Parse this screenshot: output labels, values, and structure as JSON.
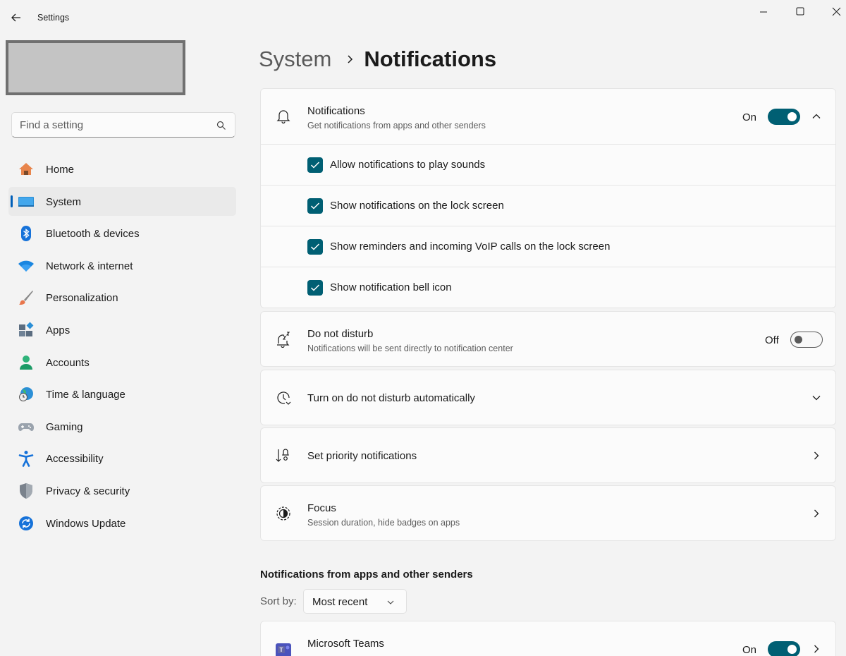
{
  "app": {
    "title": "Settings"
  },
  "search": {
    "placeholder": "Find a setting"
  },
  "sidebar": {
    "items": [
      {
        "label": "Home",
        "icon": "home-icon"
      },
      {
        "label": "System",
        "icon": "system-icon",
        "active": true
      },
      {
        "label": "Bluetooth & devices",
        "icon": "bluetooth-icon"
      },
      {
        "label": "Network & internet",
        "icon": "wifi-icon"
      },
      {
        "label": "Personalization",
        "icon": "brush-icon"
      },
      {
        "label": "Apps",
        "icon": "apps-icon"
      },
      {
        "label": "Accounts",
        "icon": "person-icon"
      },
      {
        "label": "Time & language",
        "icon": "globe-clock-icon"
      },
      {
        "label": "Gaming",
        "icon": "controller-icon"
      },
      {
        "label": "Accessibility",
        "icon": "accessibility-icon"
      },
      {
        "label": "Privacy & security",
        "icon": "shield-icon"
      },
      {
        "label": "Windows Update",
        "icon": "update-icon"
      }
    ]
  },
  "breadcrumb": {
    "parent": "System",
    "current": "Notifications"
  },
  "notifications": {
    "title": "Notifications",
    "description": "Get notifications from apps and other senders",
    "state": "On",
    "options": [
      {
        "label": "Allow notifications to play sounds",
        "checked": true
      },
      {
        "label": "Show notifications on the lock screen",
        "checked": true
      },
      {
        "label": "Show reminders and incoming VoIP calls on the lock screen",
        "checked": true
      },
      {
        "label": "Show notification bell icon",
        "checked": true
      }
    ]
  },
  "dnd": {
    "title": "Do not disturb",
    "description": "Notifications will be sent directly to notification center",
    "state": "Off"
  },
  "auto_dnd": {
    "title": "Turn on do not disturb automatically"
  },
  "priority": {
    "title": "Set priority notifications"
  },
  "focus": {
    "title": "Focus",
    "description": "Session duration, hide badges on apps"
  },
  "apps_section": {
    "title": "Notifications from apps and other senders",
    "sort_label": "Sort by:",
    "sort_value": "Most recent",
    "apps": [
      {
        "name": "Microsoft Teams",
        "state": "On"
      }
    ]
  },
  "colors": {
    "accent": "#005f73",
    "nav_indicator": "#005fb8",
    "background": "#f3f3f3",
    "card": "#fbfbfb"
  }
}
